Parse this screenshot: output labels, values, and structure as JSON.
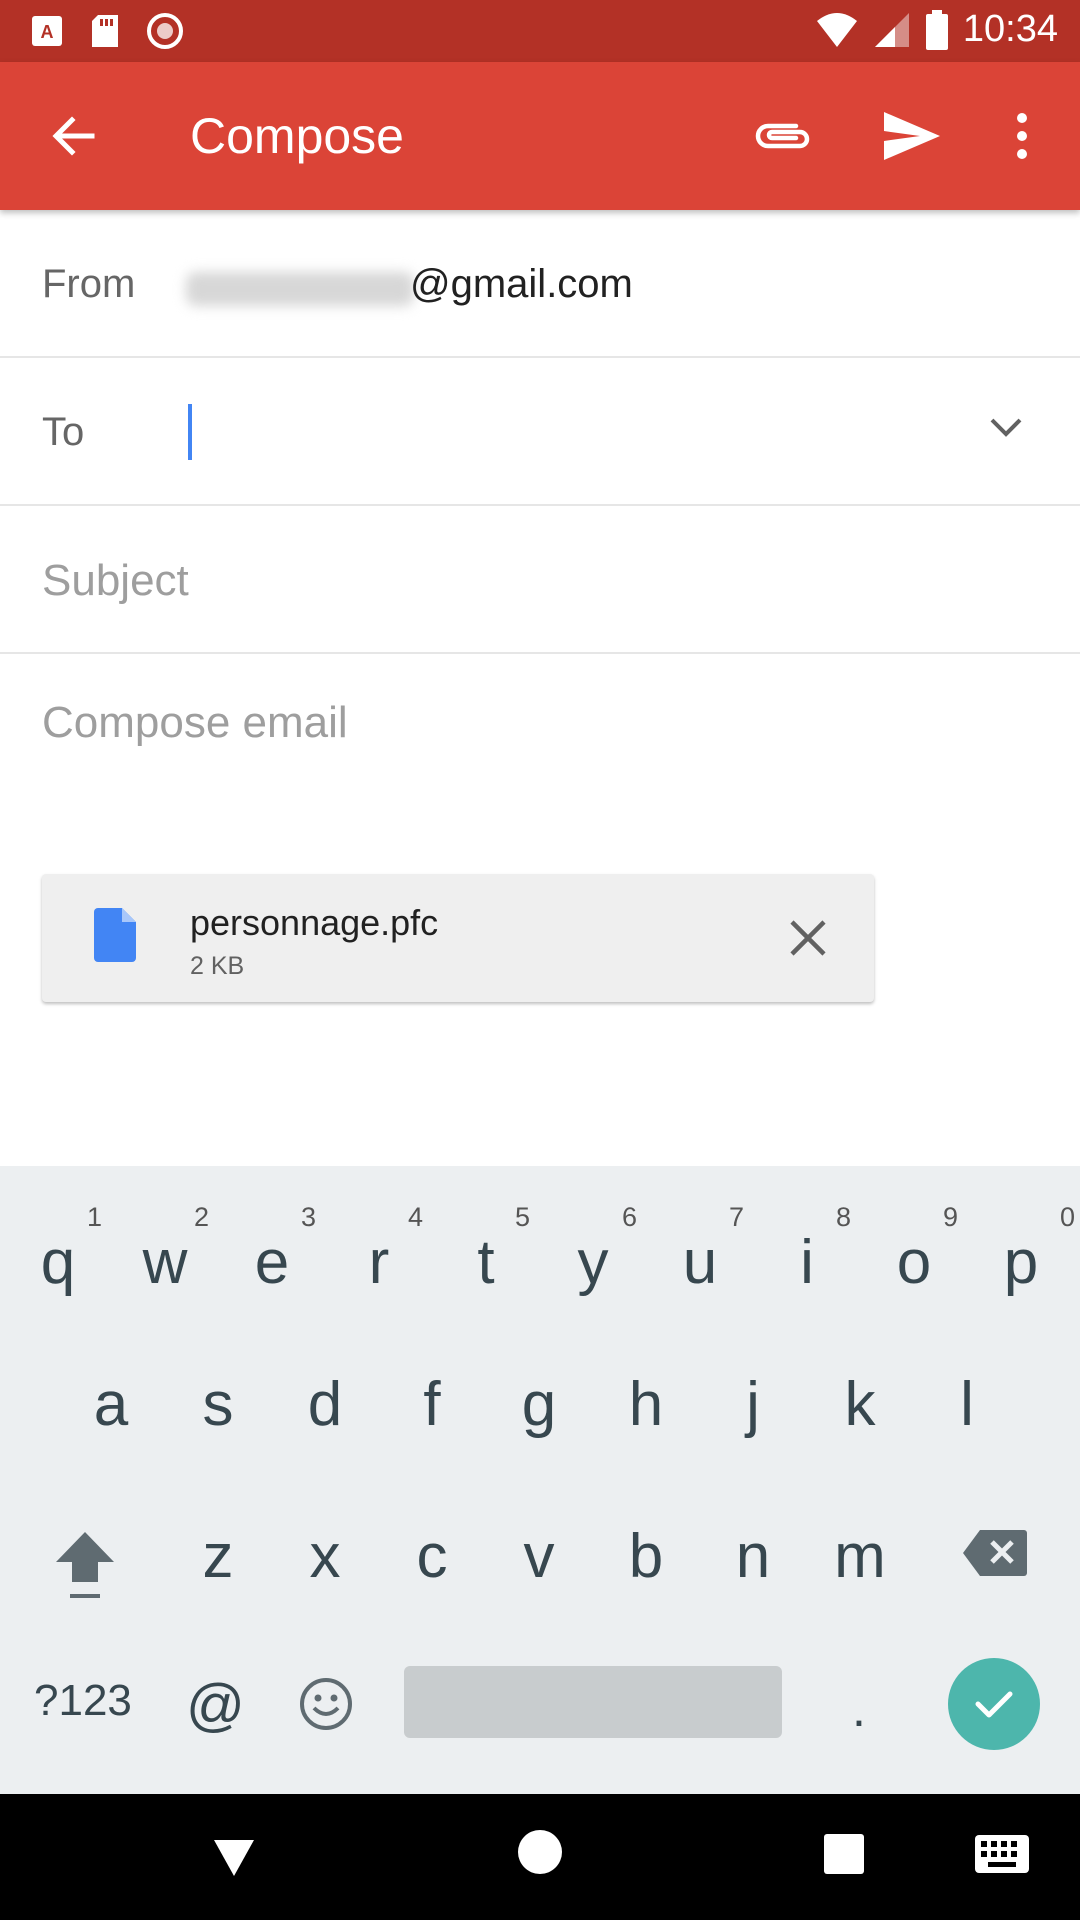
{
  "status_bar": {
    "time": "10:34",
    "icons": [
      "app-icon",
      "sd-card-icon",
      "record-icon",
      "wifi-icon",
      "signal-icon",
      "battery-icon"
    ]
  },
  "toolbar": {
    "title": "Compose",
    "icons": [
      "back-arrow-icon",
      "attach-icon",
      "send-icon",
      "more-icon"
    ]
  },
  "form": {
    "from_label": "From",
    "from_value": "@gmail.com",
    "to_label": "To",
    "subject_placeholder": "Subject",
    "body_placeholder": "Compose email"
  },
  "attachment": {
    "name": "personnage.pfc",
    "size": "2 KB"
  },
  "keyboard": {
    "row1": [
      {
        "key": "q",
        "hint": "1"
      },
      {
        "key": "w",
        "hint": "2"
      },
      {
        "key": "e",
        "hint": "3"
      },
      {
        "key": "r",
        "hint": "4"
      },
      {
        "key": "t",
        "hint": "5"
      },
      {
        "key": "y",
        "hint": "6"
      },
      {
        "key": "u",
        "hint": "7"
      },
      {
        "key": "i",
        "hint": "8"
      },
      {
        "key": "o",
        "hint": "9"
      },
      {
        "key": "p",
        "hint": "0"
      }
    ],
    "row2": [
      "a",
      "s",
      "d",
      "f",
      "g",
      "h",
      "j",
      "k",
      "l"
    ],
    "row3": [
      "z",
      "x",
      "c",
      "v",
      "b",
      "n",
      "m"
    ],
    "symbols_label": "?123",
    "at_label": "@",
    "period_label": "."
  },
  "colors": {
    "toolbar": "#db4437",
    "status_bar": "#b33126",
    "accent": "#4285f4",
    "enter": "#4db6ac"
  }
}
